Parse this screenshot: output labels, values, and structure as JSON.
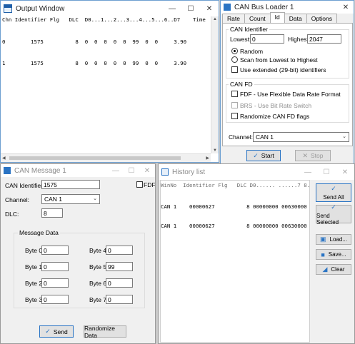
{
  "output_window": {
    "title": "Output Window",
    "header": "Chn Identifier Flg   DLC  D0...1...2...3...4...5...6..D7    Time",
    "rows": [
      "0        1575          8  0  0  0  0  0  99  0  0     3.90",
      "1        1575          8  0  0  0  0  0  99  0  0     3.90"
    ]
  },
  "bus_loader": {
    "title": "CAN Bus Loader 1",
    "tabs": [
      "Rate",
      "Count",
      "Id",
      "Data",
      "Options"
    ],
    "active_tab": "Id",
    "can_identifier_group": "CAN Identifier",
    "lowest_label": "Lowest:",
    "lowest_value": "0",
    "highest_label": "Highest:",
    "highest_value": "2047",
    "random_label": "Random",
    "scan_label": "Scan from Lowest to Highest",
    "extended_label": "Use extended (29-bit) identifiers",
    "canfd_group": "CAN FD",
    "fdf_label": "FDF - Use Flexible Data Rate Format",
    "brs_label": "BRS - Use Bit Rate Switch",
    "randomize_fd_label": "Randomize CAN FD flags",
    "channel_label": "Channel:",
    "channel_value": "CAN 1",
    "start_label": "Start",
    "stop_label": "Stop"
  },
  "can_message": {
    "title": "CAN Message 1",
    "identifier_label": "CAN Identifier:",
    "identifier_value": "1575",
    "fdf_label": "FDF",
    "channel_label": "Channel:",
    "channel_value": "CAN 1",
    "dlc_label": "DLC:",
    "dlc_value": "8",
    "message_data_label": "Message Data",
    "bytes": [
      {
        "label": "Byte 0",
        "value": "0"
      },
      {
        "label": "Byte 1",
        "value": "0"
      },
      {
        "label": "Byte 2",
        "value": "0"
      },
      {
        "label": "Byte 3",
        "value": "0"
      },
      {
        "label": "Byte 4",
        "value": "0"
      },
      {
        "label": "Byte 5",
        "value": "99"
      },
      {
        "label": "Byte 6",
        "value": "0"
      },
      {
        "label": "Byte 7",
        "value": "0"
      }
    ],
    "send_label": "Send",
    "randomize_label": "Randomize Data"
  },
  "history": {
    "title": "History list",
    "header": "WinNo  Identifier Flg   DLC D0...... ......7 8.",
    "rows": [
      "CAN 1    00000627          8 00000000 00630000",
      "CAN 1    00000627          8 00000000 00630000"
    ],
    "send_all_label": "Send All",
    "send_selected_label": "Send Selected",
    "load_label": "Load...",
    "save_label": "Save...",
    "clear_label": "Clear"
  },
  "colors": {
    "accent": "#2a74c4",
    "window_bg": "#f0f0f0"
  }
}
